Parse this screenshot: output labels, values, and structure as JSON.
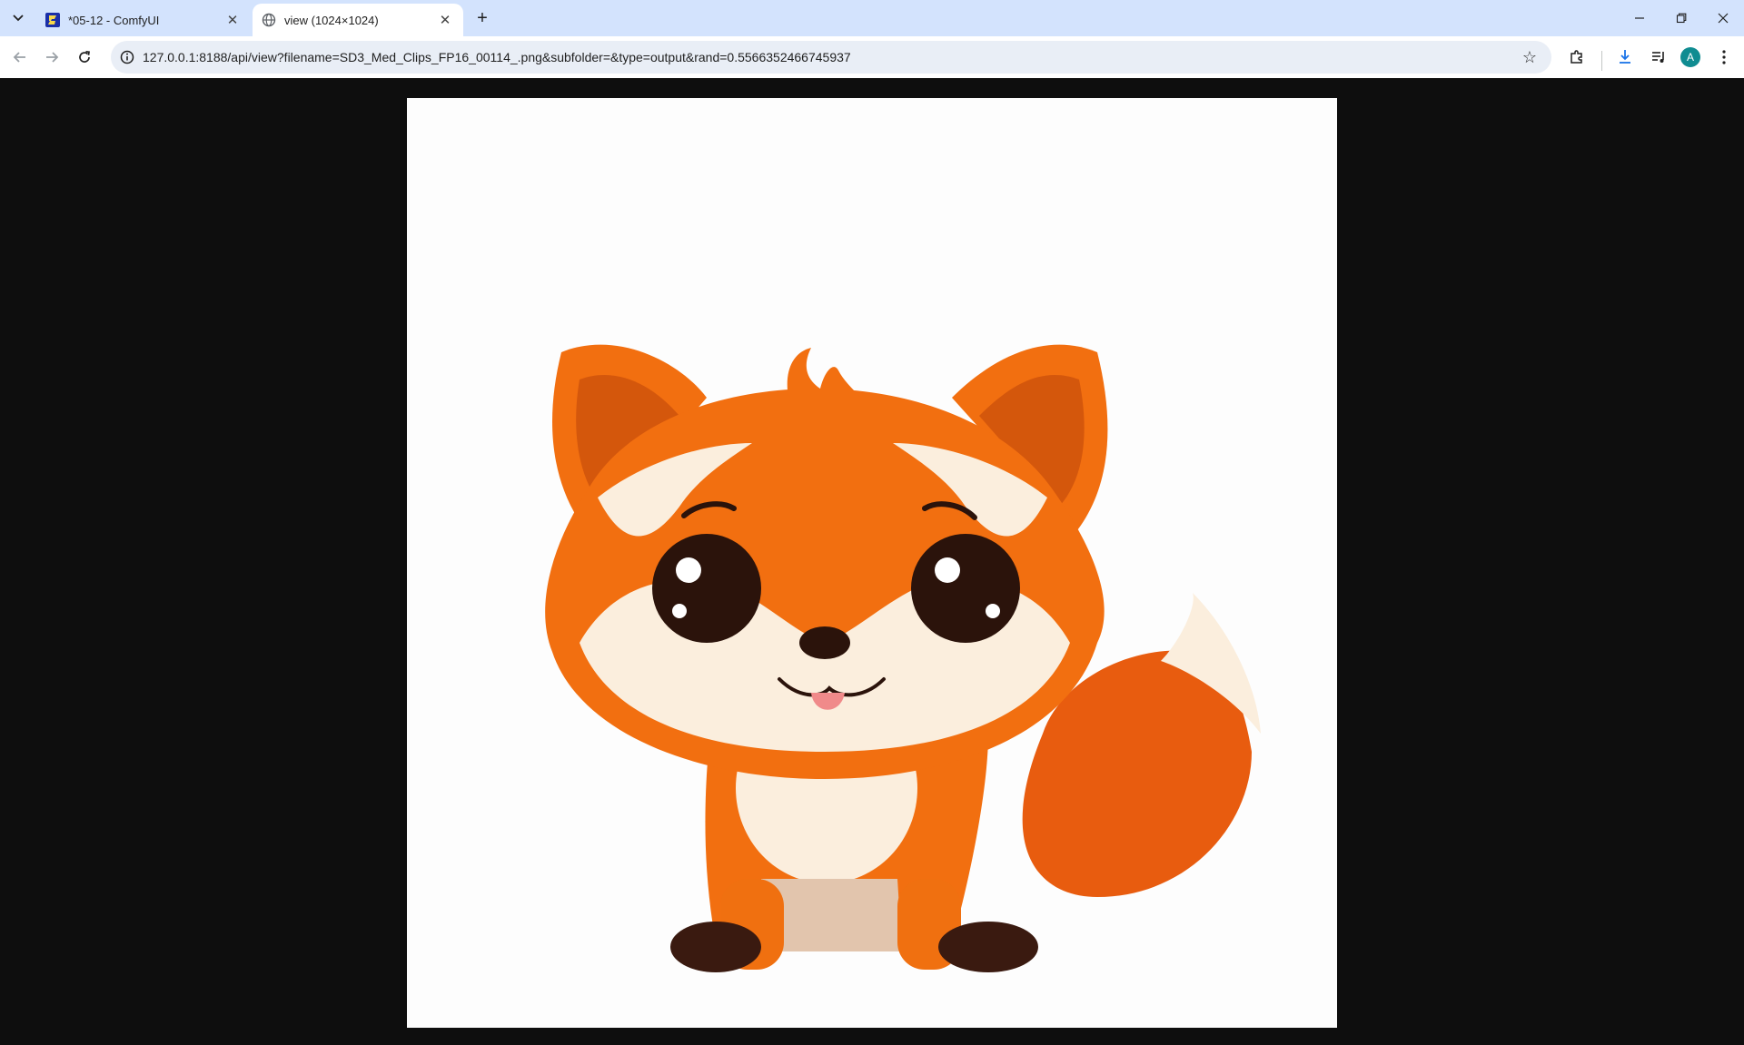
{
  "tabs": [
    {
      "title": "*05-12 - ComfyUI",
      "active": false,
      "favicon": "comfyui-logo-icon"
    },
    {
      "title": "view (1024×1024)",
      "active": true,
      "favicon": "globe-icon"
    }
  ],
  "address_bar": {
    "url": "127.0.0.1:8188/api/view?filename=SD3_Med_Clips_FP16_00114_.png&subfolder=&type=output&rand=0.5566352466745937"
  },
  "profile": {
    "initial": "A",
    "color": "#0f8c91"
  },
  "image": {
    "subject": "cartoon-fox",
    "colors": {
      "fur": "#f26f10",
      "fur_dark": "#c94a08",
      "cream": "#fbeedd",
      "eye": "#2b130b",
      "background": "#fdfdfd"
    }
  },
  "colors": {
    "tabstrip": "#d3e3fd",
    "page_background": "#0e0e0e",
    "omnibox": "#e9eef6"
  }
}
